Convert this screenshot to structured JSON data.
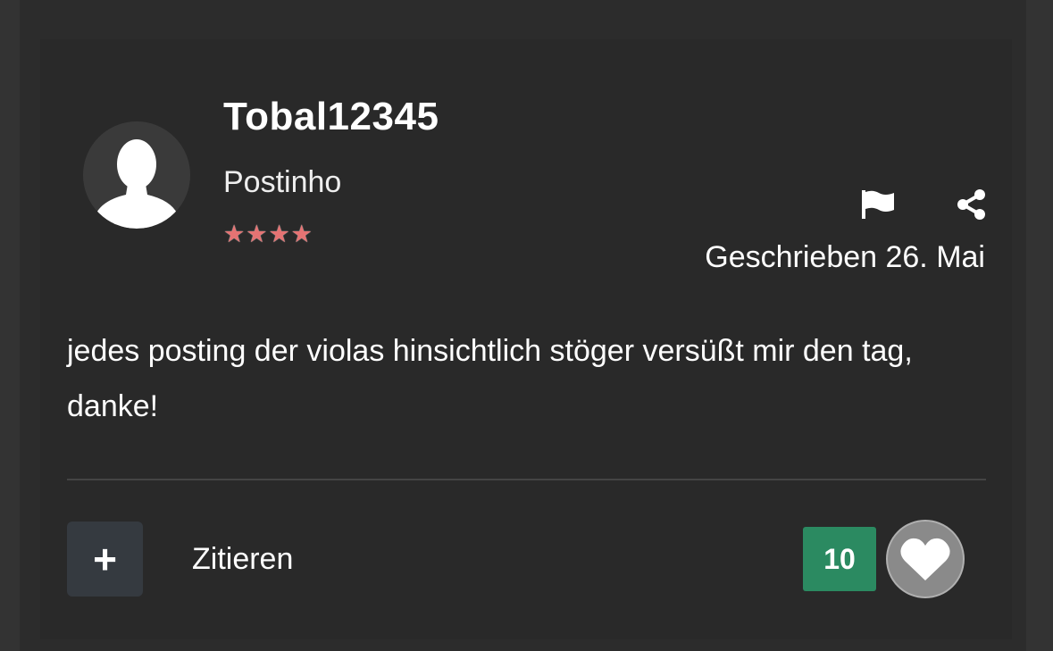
{
  "post": {
    "author": {
      "username": "Tobal12345",
      "rank": "Postinho",
      "stars": [
        "★",
        "★",
        "★",
        "★"
      ],
      "avatar_icon": "user-silhouette-icon"
    },
    "actions": {
      "report_icon": "flag-icon",
      "share_icon": "share-icon"
    },
    "date": "Geschrieben 26. Mai",
    "body": "jedes posting der violas hinsichtlich stöger versüßt mir den tag, danke!",
    "footer": {
      "multiquote_label": "+",
      "quote_label": "Zitieren",
      "like_count": "10",
      "like_icon": "heart-icon"
    }
  },
  "colors": {
    "background": "#2f2f2f",
    "card": "#292929",
    "like_count_bg": "#2b8a61",
    "star": "#e57373",
    "plus_button_bg": "#353a40",
    "like_button_bg": "#8a8a8a"
  }
}
